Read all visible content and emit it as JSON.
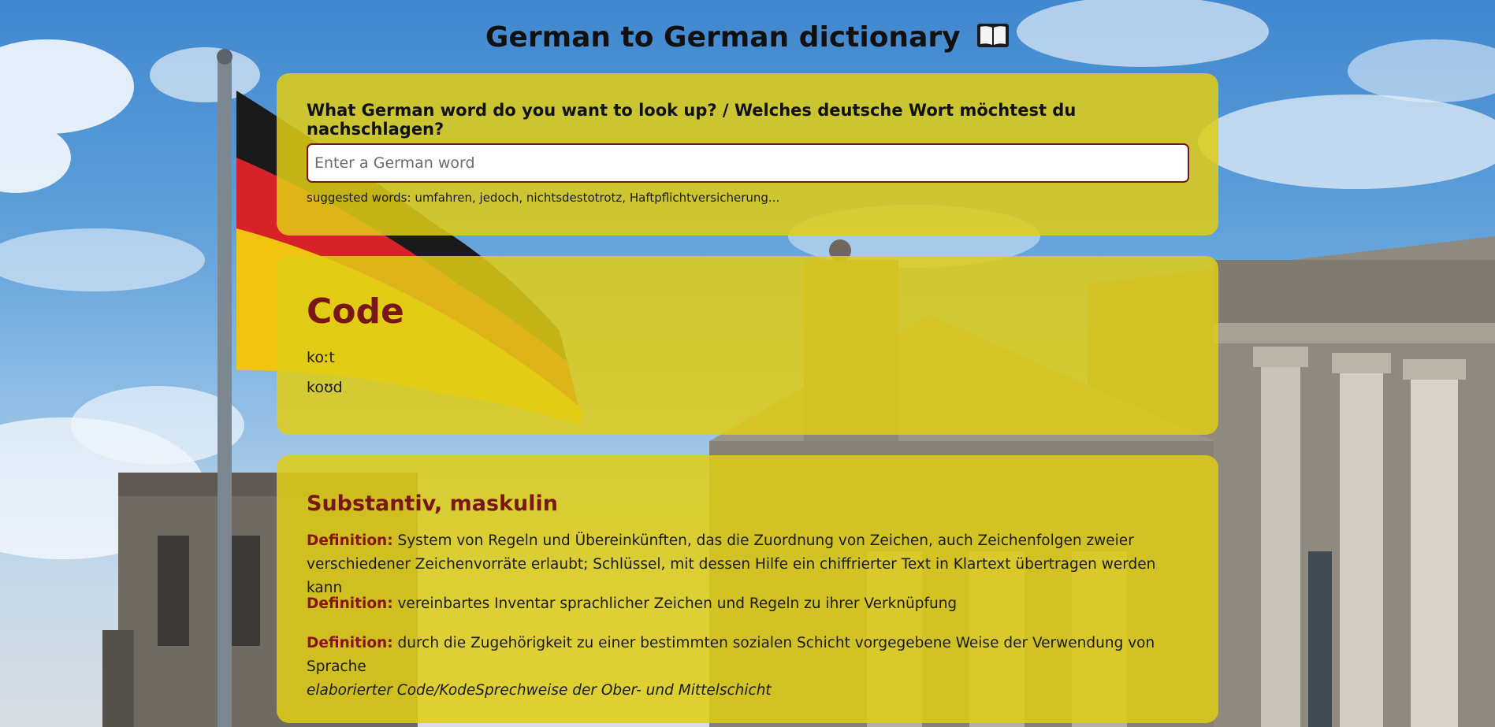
{
  "header": {
    "title": "German to German dictionary",
    "title_icon": "open-book-icon"
  },
  "search": {
    "question": "What German word do you want to look up? / Welches deutsche Wort möchtest du nachschlagen?",
    "placeholder": "Enter a German word",
    "value": "",
    "suggestions": "suggested words: umfahren, jedoch, nichtsdestotrotz, Haftpflichtversicherung..."
  },
  "entry": {
    "word": "Code",
    "pronunciations": [
      "koːt",
      "koʊd"
    ]
  },
  "meanings": {
    "part_of_speech": "Substantiv, maskulin",
    "definition_label": "Definition:",
    "definitions": [
      {
        "text": "System von Regeln und Übereinkünften, das die Zuordnung von Zeichen, auch Zeichenfolgen zweier verschiedener Zeichenvorräte erlaubt; Schlüssel, mit dessen Hilfe ein chiffrierter Text in Klartext übertragen werden kann"
      },
      {
        "text": "vereinbartes Inventar sprachlicher Zeichen und Regeln zu ihrer Verknüpfung"
      },
      {
        "text": "durch die Zugehörigkeit zu einer bestimmten sozialen Schicht vorgegebene Weise der Verwendung von Sprache",
        "example": "elaborierter Code/KodeSprechweise der Ober- und Mittelschicht"
      }
    ]
  },
  "colors": {
    "card_background": "#dfcd16",
    "accent_text": "#7a1616",
    "input_border": "#7a1418",
    "sky": "#4a8fd4"
  }
}
